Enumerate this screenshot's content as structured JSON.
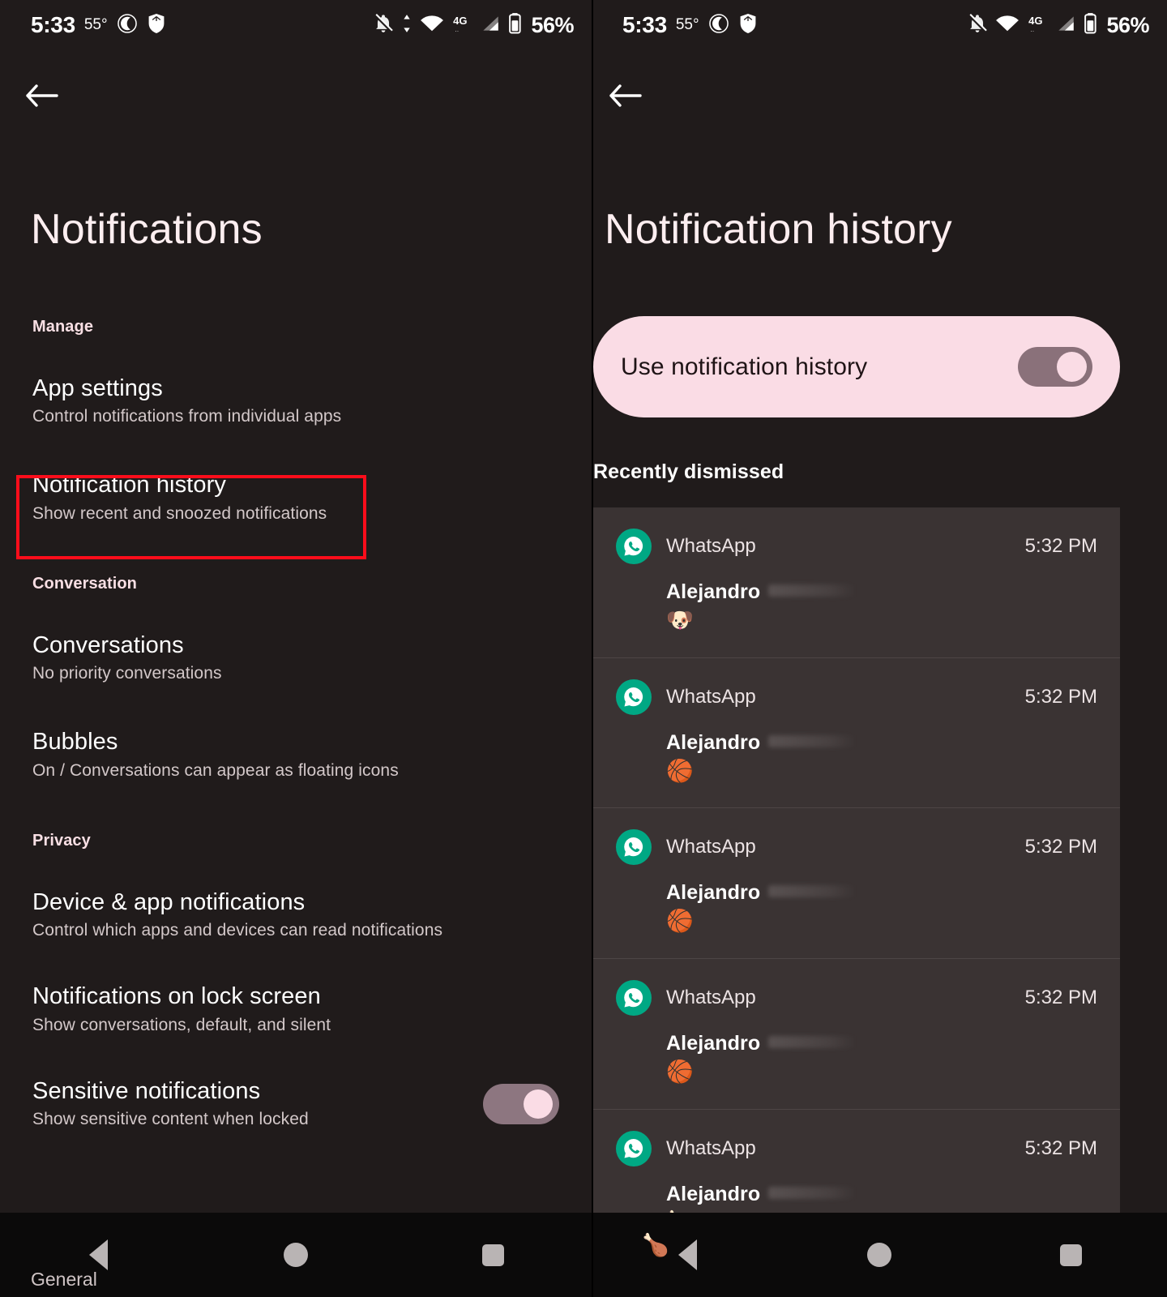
{
  "left": {
    "statusbar": {
      "time": "5:33",
      "temperature": "55°",
      "battery": "56%",
      "icons_left": [
        "moon-icon",
        "shield-icon"
      ],
      "icons_right": [
        "notifications-off-icon",
        "data-transfer-icon",
        "wifi-icon",
        "4g-icon",
        "signal-icon",
        "battery-icon"
      ]
    },
    "back_label": "back-arrow",
    "title": "Notifications",
    "sections": [
      {
        "header": "Manage",
        "items": [
          {
            "title": "App settings",
            "subtitle": "Control notifications from individual apps",
            "highlighted": false
          },
          {
            "title": "Notification history",
            "subtitle": "Show recent and snoozed notifications",
            "highlighted": true
          }
        ]
      },
      {
        "header": "Conversation",
        "items": [
          {
            "title": "Conversations",
            "subtitle": "No priority conversations",
            "highlighted": false
          },
          {
            "title": "Bubbles",
            "subtitle": "On / Conversations can appear as floating icons",
            "highlighted": false
          }
        ]
      },
      {
        "header": "Privacy",
        "items": [
          {
            "title": "Device & app notifications",
            "subtitle": "Control which apps and devices can read notifications",
            "highlighted": false
          },
          {
            "title": "Notifications on lock screen",
            "subtitle": "Show conversations, default, and silent",
            "highlighted": false
          },
          {
            "title": "Sensitive notifications",
            "subtitle": "Show sensitive content when locked",
            "toggle": "on",
            "highlighted": false
          }
        ]
      }
    ],
    "footer_label": "General",
    "highlight_color": "#fc0d1b"
  },
  "right": {
    "statusbar": {
      "time": "5:33",
      "temperature": "55°",
      "battery": "56%",
      "icons_left": [
        "moon-icon",
        "shield-icon"
      ],
      "icons_right": [
        "notifications-off-icon",
        "wifi-icon",
        "4g-icon",
        "signal-icon",
        "battery-icon"
      ]
    },
    "back_label": "back-arrow",
    "title": "Notification history",
    "use_history": {
      "label": "Use notification history",
      "state": "on",
      "card_color": "#fadce5",
      "track_color": "#8a717a",
      "knob_color": "#fadce5"
    },
    "recent_header": "Recently dismissed",
    "notifications": [
      {
        "app": "WhatsApp",
        "time": "5:32 PM",
        "sender": "Alejandro",
        "redacted": true,
        "emoji": "🐶"
      },
      {
        "app": "WhatsApp",
        "time": "5:32 PM",
        "sender": "Alejandro",
        "redacted": true,
        "emoji": "🏀"
      },
      {
        "app": "WhatsApp",
        "time": "5:32 PM",
        "sender": "Alejandro",
        "redacted": true,
        "emoji": "🏀"
      },
      {
        "app": "WhatsApp",
        "time": "5:32 PM",
        "sender": "Alejandro",
        "redacted": true,
        "emoji": "🏀"
      },
      {
        "app": "WhatsApp",
        "time": "5:32 PM",
        "sender": "Alejandro",
        "redacted": true,
        "emoji": "🍗"
      }
    ],
    "peek_emoji": "🍗"
  },
  "navbar": {
    "back": "back-triangle-icon",
    "home": "home-circle-icon",
    "recents": "recents-square-icon"
  },
  "colors": {
    "background": "#201b1b",
    "card": "#3a3333",
    "accent_pink": "#fadce5",
    "whatsapp_green": "#00a884",
    "highlight_red": "#fc0d1b"
  }
}
